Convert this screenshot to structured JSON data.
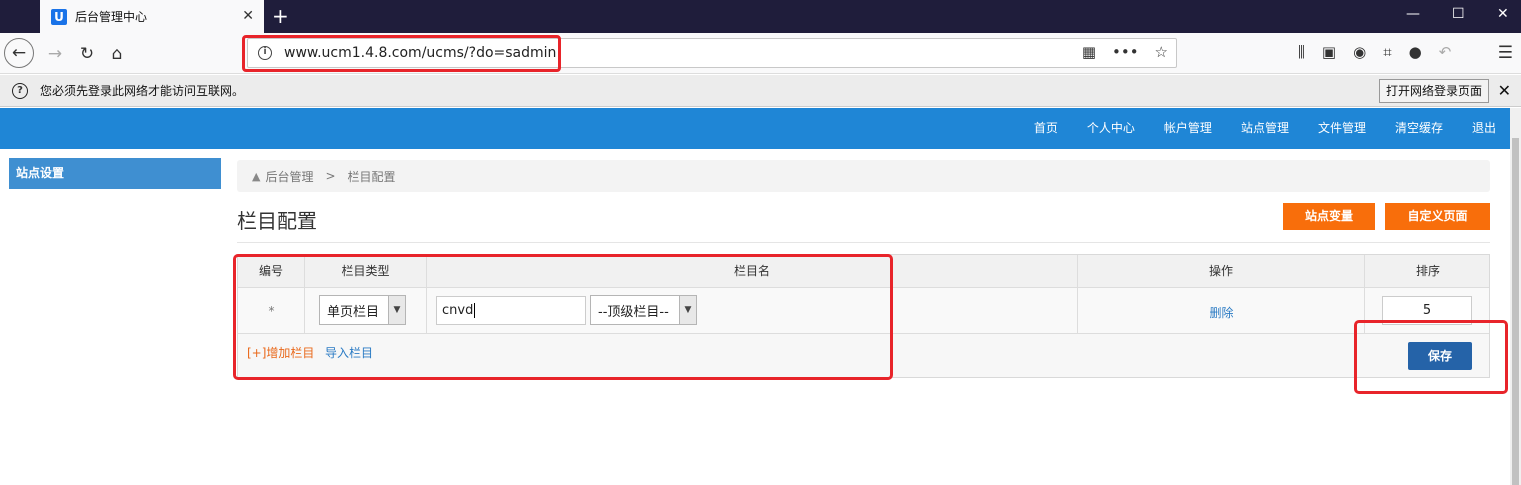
{
  "browser": {
    "tab_title": "后台管理中心",
    "tab_icon": "U",
    "url": "www.ucm1.4.8.com/ucms/?do=sadmin",
    "infobar_text": "您必须先登录此网络才能访问互联网。",
    "infobar_button": "打开网络登录页面"
  },
  "topnav": {
    "items": [
      "首页",
      "个人中心",
      "帐户管理",
      "站点管理",
      "文件管理",
      "清空缓存",
      "退出"
    ]
  },
  "sidebar": {
    "items": [
      {
        "label": "站点设置"
      }
    ]
  },
  "breadcrumb": {
    "home": "后台管理",
    "separator": ">",
    "current": "栏目配置"
  },
  "page": {
    "title": "栏目配置",
    "btn_vars": "站点变量",
    "btn_custom": "自定义页面"
  },
  "table": {
    "headers": {
      "no": "编号",
      "type": "栏目类型",
      "name": "栏目名",
      "op": "操作",
      "sort": "排序"
    },
    "rows": [
      {
        "no": "*",
        "type": "单页栏目",
        "name": "cnvd",
        "parent": "--顶级栏目--",
        "op": "删除",
        "sort": "5"
      }
    ],
    "add_label": "[+]增加栏目",
    "import_label": "导入栏目",
    "save_label": "保存"
  },
  "colors": {
    "nav_bg": "#1f86d6",
    "sidebar_active": "#3f8fd1",
    "orange": "#f86e0b",
    "save_blue": "#2563a8",
    "annotation_red": "#e8242a"
  }
}
